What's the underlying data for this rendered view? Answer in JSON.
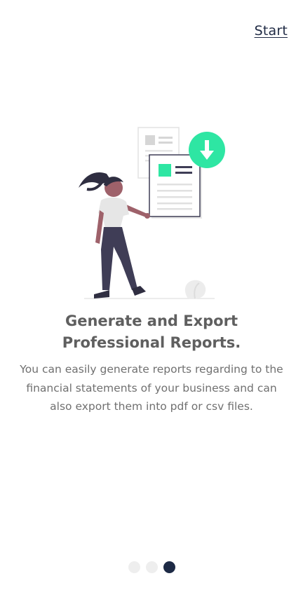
{
  "header": {
    "start_label": "Start"
  },
  "slide": {
    "title": "Generate and Export Professional Reports.",
    "description": "You can easily generate reports regarding to the financial statements of your business and can also export them into pdf or csv files."
  },
  "pagination": {
    "total": 3,
    "current": 3
  },
  "colors": {
    "accent": "#2ee6a3",
    "dark": "#1d2a45",
    "dot_inactive": "#eeeeee"
  },
  "icons": {
    "illustration": "woman-holding-report-illustration",
    "download": "download-arrow-icon"
  }
}
